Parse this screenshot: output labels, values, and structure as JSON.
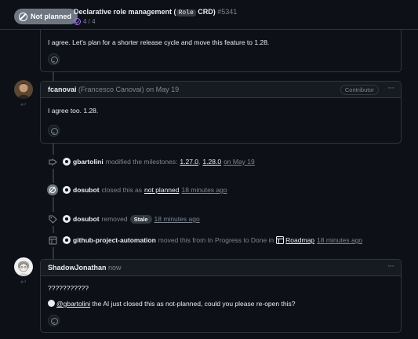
{
  "header": {
    "state_label": "Not planned",
    "title_prefix": "Declarative role management (",
    "title_code": "Role",
    "title_suffix": " CRD)",
    "issue_number": "#5341",
    "tasks": "4 / 4"
  },
  "comments": [
    {
      "body": "I agree. Let's plan for a shorter release cycle and move this feature to 1.28."
    },
    {
      "author": "fcanovai",
      "author_full": "(Francesco Canovai)",
      "date": "on May 19",
      "badge": "Contributor",
      "more": "···",
      "body": "I agree too. 1.28."
    },
    {
      "author": "ShadowJonathan",
      "date": "now",
      "more": "···",
      "body_line1": "???????????",
      "mention": "@gbartolini",
      "body_line2": " the AI just closed this as not-planned, could you please re-open this?"
    }
  ],
  "events": [
    {
      "actor": "gbartolini",
      "text": "modified the milestones:",
      "milestone1": "1.27.0",
      "milestone2": "1.28.0",
      "time": "on May 19"
    },
    {
      "actor": "dosubot",
      "text": "closed this as",
      "reason": "not planned",
      "time": "18 minutes ago"
    },
    {
      "actor": "dosubot",
      "text": "removed",
      "label": "Stale",
      "time": "18 minutes ago"
    },
    {
      "actor": "github-project-automation",
      "text": "moved this from In Progress to Done in",
      "project": "Roadmap",
      "time": "18 minutes ago"
    }
  ],
  "colors": {
    "background": "#0d1117",
    "border": "#30363d",
    "muted_text": "#7d8590",
    "closed_gray": "#6e7681",
    "task_purple": "#a371f7"
  }
}
